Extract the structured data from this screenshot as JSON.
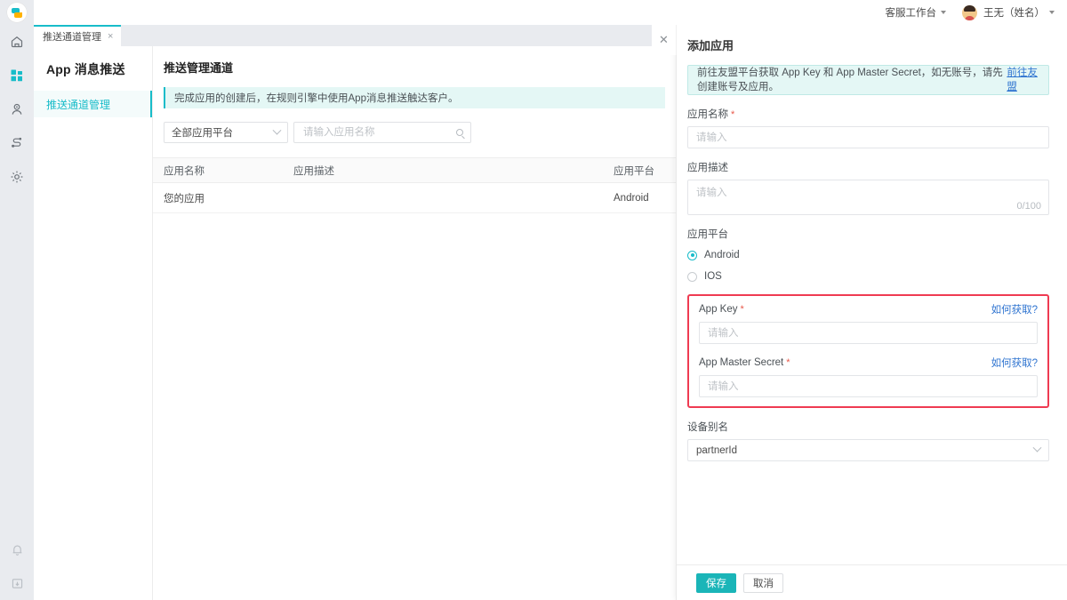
{
  "header": {
    "logo_icon": "app-logo-icon",
    "workbench_label": "客服工作台",
    "user_name": "王无（姓名）"
  },
  "rail": {
    "items": [
      {
        "icon": "home-icon",
        "name": "rail-item-home",
        "active": false
      },
      {
        "icon": "apps-grid-icon",
        "name": "rail-item-apps",
        "active": true
      },
      {
        "icon": "user-icon",
        "name": "rail-item-customer",
        "active": false
      },
      {
        "icon": "flow-icon",
        "name": "rail-item-flow",
        "active": false
      },
      {
        "icon": "gear-icon",
        "name": "rail-item-settings",
        "active": false
      }
    ],
    "bottom_items": [
      {
        "icon": "bell-icon",
        "name": "rail-item-notifications"
      },
      {
        "icon": "collapse-panel-icon",
        "name": "rail-item-collapse"
      }
    ]
  },
  "tabs": {
    "items": [
      {
        "label": "推送通道管理",
        "close": "×",
        "active": true
      }
    ]
  },
  "module_nav": {
    "title": "App 消息推送",
    "items": [
      {
        "label": "推送通道管理",
        "active": true
      }
    ]
  },
  "main": {
    "page_title": "推送管理通道",
    "notice": "完成应用的创建后，在规则引擎中使用App消息推送触达客户。",
    "filters": {
      "platform_select_value": "全部应用平台",
      "search_placeholder": "请输入应用名称",
      "search_value": "",
      "search_icon": "search-icon",
      "chevron_icon": "chevron-down-icon"
    },
    "table": {
      "columns": [
        "应用名称",
        "应用描述",
        "应用平台"
      ],
      "rows": [
        {
          "name": "您的应用",
          "desc": "",
          "platform": "Android"
        }
      ]
    }
  },
  "drawer": {
    "close_icon": "close-icon",
    "title": "添加应用",
    "hint_text": "前往友盟平台获取 App Key 和 App Master Secret，如无账号，请先创建账号及应用。",
    "hint_link": "前往友盟",
    "app_name": {
      "label": "应用名称",
      "required_mark": "*",
      "placeholder": "请输入",
      "value": ""
    },
    "app_desc": {
      "label": "应用描述",
      "placeholder": "请输入",
      "value": "",
      "counter": "0/100"
    },
    "platform": {
      "label": "应用平台",
      "options": [
        {
          "label": "Android",
          "checked": true
        },
        {
          "label": "IOS",
          "checked": false
        }
      ]
    },
    "app_key": {
      "label": "App Key",
      "required_mark": "*",
      "help_link": "如何获取?",
      "placeholder": "请输入",
      "value": ""
    },
    "app_master_secret": {
      "label": "App Master Secret",
      "required_mark": "*",
      "help_link": "如何获取?",
      "placeholder": "请输入",
      "value": ""
    },
    "device_alias": {
      "label": "设备别名",
      "value": "partnerId",
      "chevron_icon": "chevron-down-icon"
    },
    "footer": {
      "save_label": "保存",
      "cancel_label": "取消"
    }
  },
  "colors": {
    "accent": "#18bcc9",
    "primary_button": "#1ab5b8",
    "notice_bg": "#e4f7f5",
    "highlight_border": "#ef3b52",
    "link": "#2f74d0",
    "required": "#e8594a"
  }
}
